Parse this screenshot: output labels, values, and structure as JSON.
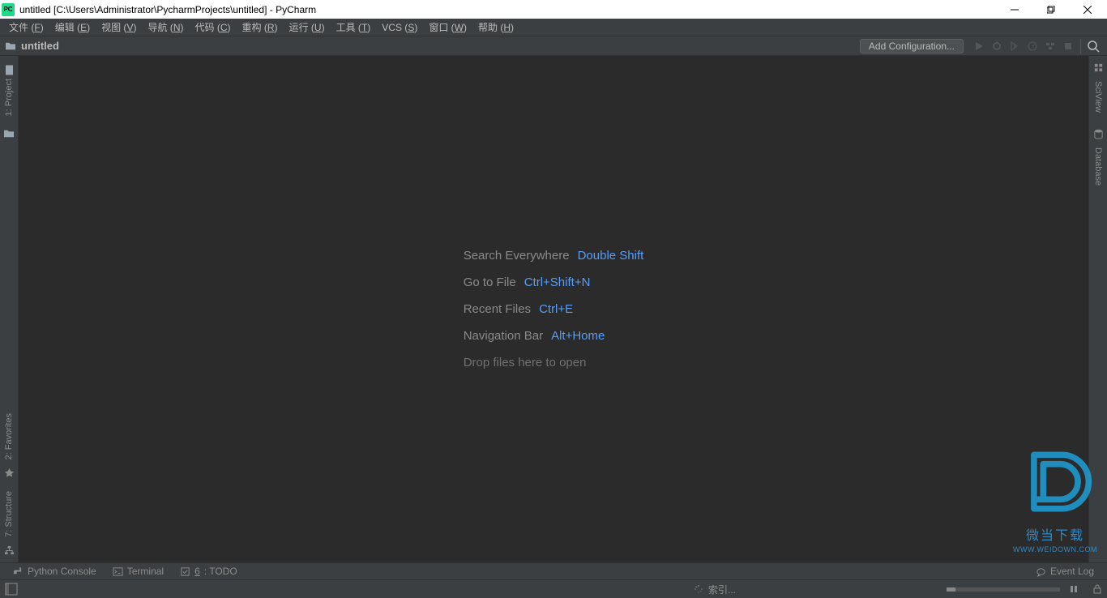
{
  "title": "untitled [C:\\Users\\Administrator\\PycharmProjects\\untitled] - PyCharm",
  "app_icon_text": "PC",
  "menu": [
    {
      "label": "文件",
      "mnemonic": "F"
    },
    {
      "label": "编辑",
      "mnemonic": "E"
    },
    {
      "label": "视图",
      "mnemonic": "V"
    },
    {
      "label": "导航",
      "mnemonic": "N"
    },
    {
      "label": "代码",
      "mnemonic": "C"
    },
    {
      "label": "重构",
      "mnemonic": "R"
    },
    {
      "label": "运行",
      "mnemonic": "U"
    },
    {
      "label": "工具",
      "mnemonic": "T"
    },
    {
      "label": "VCS",
      "mnemonic": "S"
    },
    {
      "label": "窗口",
      "mnemonic": "W"
    },
    {
      "label": "帮助",
      "mnemonic": "H"
    }
  ],
  "nav": {
    "project_name": "untitled",
    "add_config": "Add Configuration..."
  },
  "left_tools": {
    "project": "1: Project",
    "favorites": "2: Favorites",
    "structure": "7: Structure"
  },
  "right_tools": {
    "sciview": "SciView",
    "database": "Database"
  },
  "empty_state": {
    "search_label": "Search Everywhere",
    "search_key": "Double Shift",
    "goto_label": "Go to File",
    "goto_key": "Ctrl+Shift+N",
    "recent_label": "Recent Files",
    "recent_key": "Ctrl+E",
    "navbar_label": "Navigation Bar",
    "navbar_key": "Alt+Home",
    "drop_label": "Drop files here to open"
  },
  "bottom": {
    "python_console": "Python Console",
    "terminal": "Terminal",
    "todo_num": "6",
    "todo_label": ": TODO",
    "event_log": "Event Log"
  },
  "status": {
    "indexing": "索引..."
  },
  "watermark": {
    "text": "微当下载",
    "url": "WWW.WEIDOWN.COM"
  }
}
